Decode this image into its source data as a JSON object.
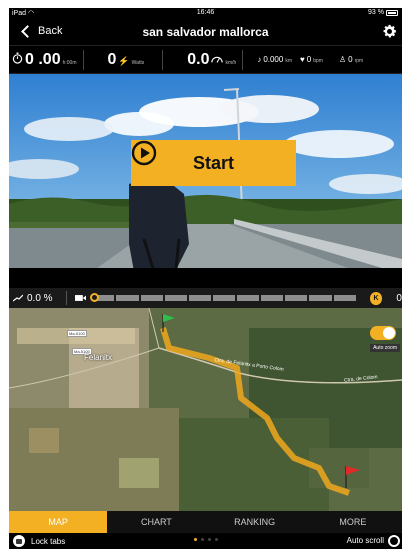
{
  "status": {
    "device": "iPad",
    "time": "16:46",
    "battery": "93 %"
  },
  "nav": {
    "back_label": "Back",
    "title": "san salvador mallorca"
  },
  "stats": {
    "time_value": "0 .00",
    "time_unit": "h:00m",
    "power_value": "0",
    "power_unit": "Watts",
    "speed_value": "0.0",
    "speed_unit": "km/h",
    "distance": "0.000",
    "distance_unit": "km",
    "heart": "0",
    "heart_unit": "bpm",
    "cadence": "0",
    "cadence_unit": "rpm"
  },
  "video": {
    "start_label": "Start"
  },
  "progress": {
    "grade": "0.0 %",
    "position": 0.0,
    "coins": "0",
    "coin_symbol": "K"
  },
  "map": {
    "town": "Felanitx",
    "road_tags": [
      "Ma-5100",
      "Ma-5100"
    ],
    "road_label": "Ctra. de Felanitx a Porto Colom",
    "road_label_2": "Ctra. de Colom",
    "auto_zoom_label": "Auto zoom",
    "auto_zoom_on": true
  },
  "tabs": [
    {
      "label": "MAP",
      "active": true
    },
    {
      "label": "CHART",
      "active": false
    },
    {
      "label": "RANKING",
      "active": false
    },
    {
      "label": "MORE",
      "active": false
    }
  ],
  "bottom": {
    "lock_label": "Lock tabs",
    "autoscroll_label": "Auto scroll",
    "page_count": 4,
    "current_page": 1
  },
  "colors": {
    "accent": "#f4b023",
    "route": "#f0a81c",
    "background": "#000000"
  },
  "icons": [
    "wifi-icon",
    "battery-icon",
    "back-chevron-icon",
    "gear-icon",
    "stopwatch-icon",
    "power-icon",
    "speedometer-icon",
    "distance-icon",
    "heart-icon",
    "cadence-icon",
    "play-icon",
    "grade-icon",
    "video-camera-icon",
    "coin-icon",
    "start-flag-icon",
    "finish-flag-icon",
    "lock-icon",
    "autoscroll-icon"
  ]
}
